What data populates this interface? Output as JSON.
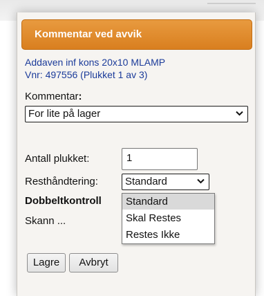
{
  "dialog": {
    "title": "Kommentar ved avvik",
    "item_name": "Addaven inf kons 20x10 MLAMP",
    "item_info": "Vnr: 497556 (Plukket 1 av 3)"
  },
  "comment": {
    "label": "Kommentar",
    "label_colon": ":",
    "selected": "For lite på lager"
  },
  "picked": {
    "label": "Antall plukket:",
    "value": "1"
  },
  "rest": {
    "label": "Resthåndtering:",
    "selected": "Standard",
    "options": [
      "Standard",
      "Skal Restes",
      "Restes Ikke"
    ]
  },
  "double_check": {
    "label": "Dobbeltkontroll",
    "scan_label": "Skann ..."
  },
  "buttons": {
    "save": "Lagre",
    "cancel": "Avbryt"
  },
  "colors": {
    "header_orange": "#e0892c",
    "item_blue": "#1b3b9a",
    "dialog_bg": "#f6f4f1"
  }
}
